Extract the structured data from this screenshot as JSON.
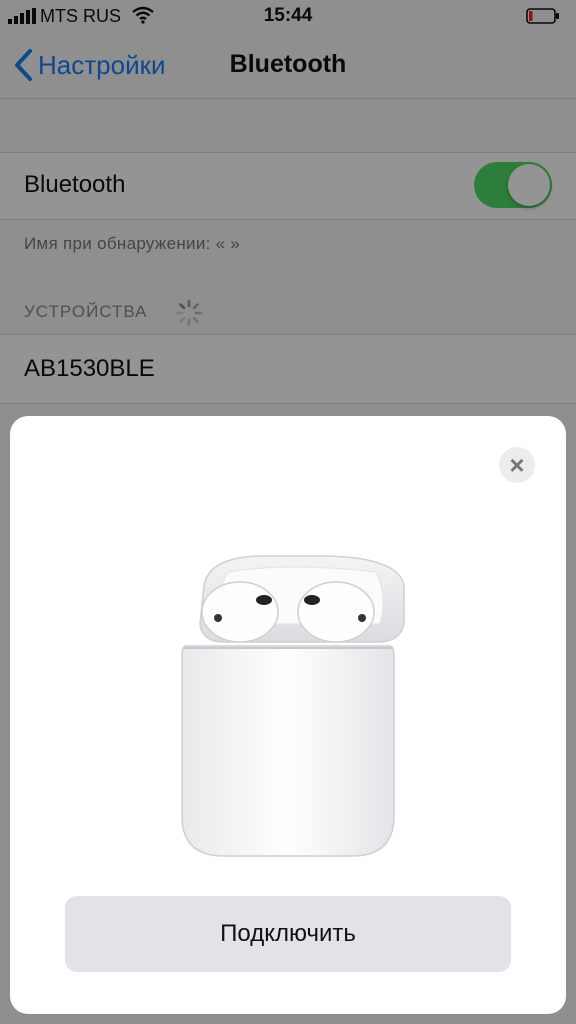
{
  "status_bar": {
    "carrier": "MTS RUS",
    "time": "15:44",
    "battery_level": 0.15
  },
  "nav": {
    "back_label": "Настройки",
    "title": "Bluetooth"
  },
  "bluetooth_row": {
    "label": "Bluetooth",
    "enabled": true,
    "toggle_color": "#4cd964"
  },
  "discoverable_text": "Имя при обнаружении: «                              »",
  "devices": {
    "header": "УСТРОЙСТВА",
    "items": [
      {
        "name": "AB1530BLE"
      }
    ]
  },
  "modal": {
    "close_icon": "close-icon",
    "image": "airpods-case-image",
    "connect_label": "Подключить"
  },
  "colors": {
    "accent": "#1a7cf5",
    "toggle_on": "#4cd964"
  }
}
